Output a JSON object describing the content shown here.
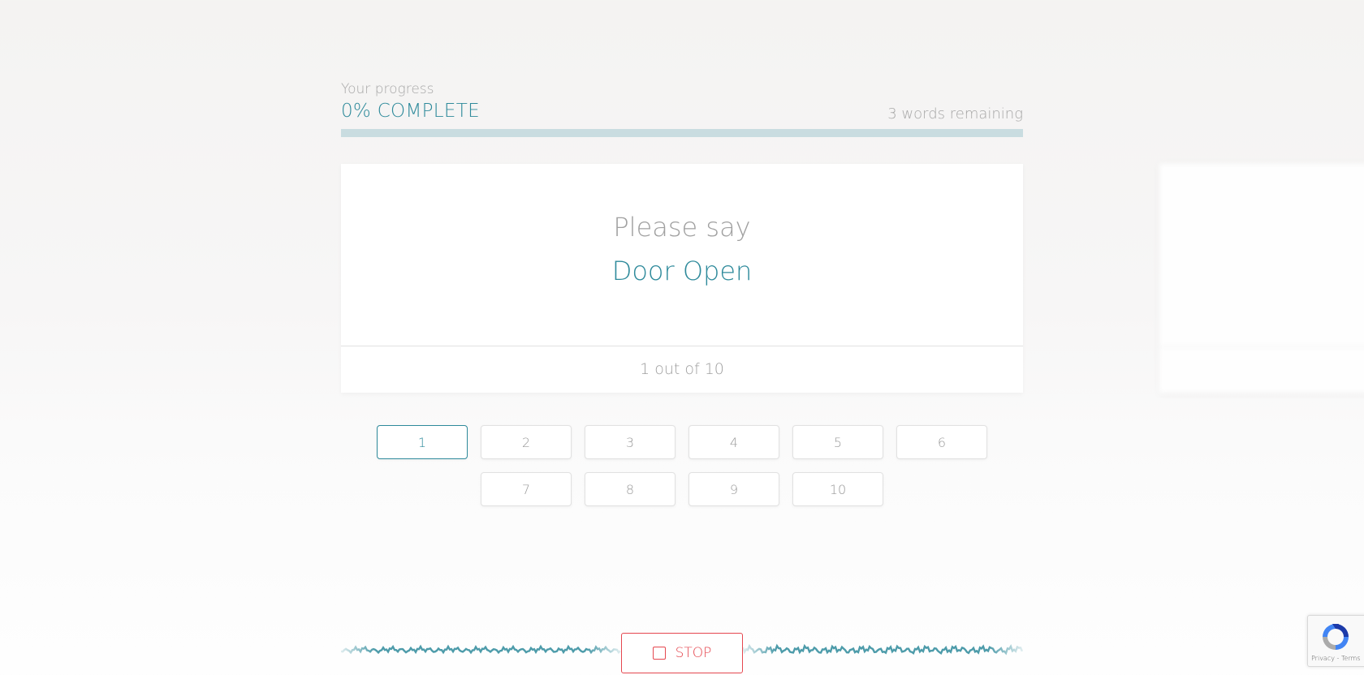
{
  "progress": {
    "caption": "Your progress",
    "percent_label": "0% COMPLETE",
    "remaining_label": "3 words remaining",
    "value": 0
  },
  "prompt": {
    "label": "Please say",
    "word": "Door Open",
    "counter": "1 out of 10"
  },
  "word_buttons": {
    "row1": [
      "1",
      "2",
      "3",
      "4",
      "5",
      "6"
    ],
    "row2": [
      "7",
      "8",
      "9",
      "10"
    ],
    "active": "1"
  },
  "recorder": {
    "stop_label": "STOP"
  },
  "recaptcha": {
    "privacy": "Privacy",
    "separator": " - ",
    "terms": "Terms"
  },
  "colors": {
    "accent": "#2e8a9b",
    "stop": "#e5474f",
    "muted_text": "#a0a0a0",
    "track": "#c9dce0"
  },
  "icons": {
    "stop": "stop-square-icon",
    "recaptcha": "recaptcha-logo-icon"
  }
}
